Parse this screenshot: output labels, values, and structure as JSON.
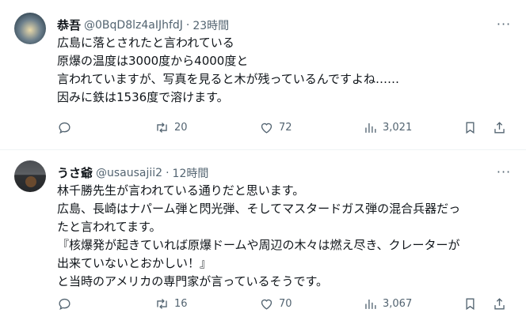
{
  "tweets": [
    {
      "name": "恭吾",
      "handle": "@0BqD8lz4aIJhfdJ",
      "separator": "·",
      "time": "23時間",
      "more": "···",
      "lines": [
        "広島に落とされたと言われている",
        "原爆の温度は3000度から4000度と",
        "言われていますが、写真を見ると木が残っているんですよね……",
        "因みに鉄は1536度で溶けます。"
      ],
      "retweets": "20",
      "likes": "72",
      "views": "3,021"
    },
    {
      "name": "うさ爺",
      "handle": "@usausajii2",
      "separator": "·",
      "time": "12時間",
      "more": "···",
      "lines": [
        "林千勝先生が言われている通りだと思います。",
        "広島、長崎はナパーム弾と閃光弾、そしてマスタードガス弾の混合兵器だっ",
        "たと言われてます。",
        "『核爆発が起きていれば原爆ドームや周辺の木々は燃え尽き、クレーターが",
        "出来ていないとおかしい！』",
        "と当時のアメリカの専門家が言っているそうです。"
      ],
      "retweets": "16",
      "likes": "70",
      "views": "3,067"
    }
  ],
  "colors": {
    "text": "#0f1419",
    "secondary": "#536471",
    "divider": "#eff3f4"
  },
  "icons": [
    "reply-icon",
    "retweet-icon",
    "like-icon",
    "views-icon",
    "bookmark-icon",
    "share-icon",
    "more-icon"
  ]
}
